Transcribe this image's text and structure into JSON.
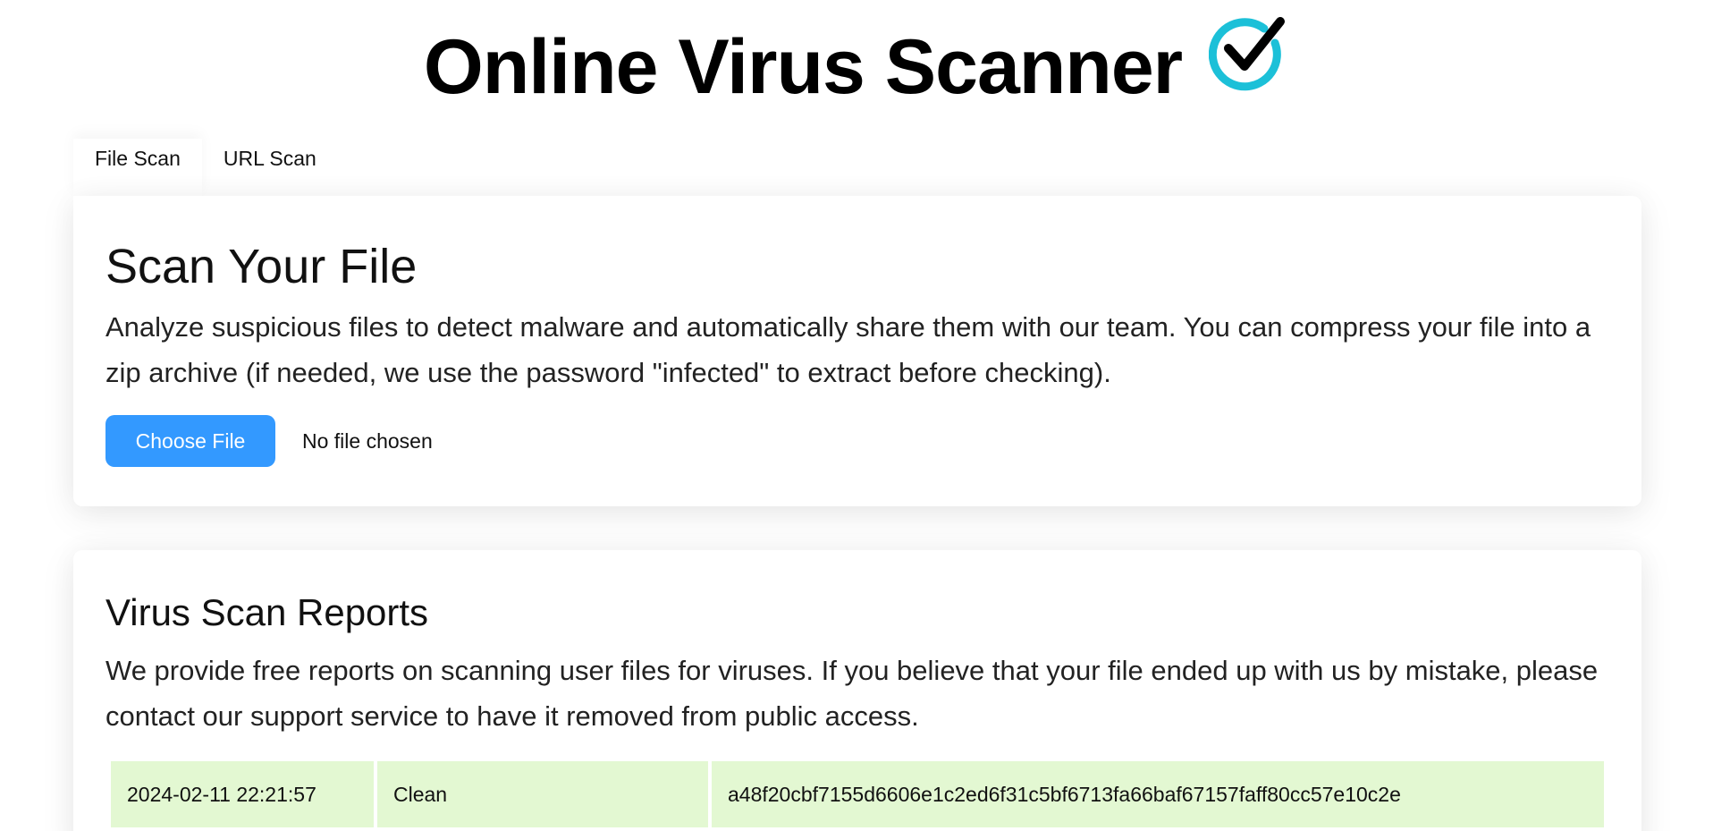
{
  "header": {
    "title": "Online Virus Scanner",
    "icon": "check-circle-icon",
    "icon_color": "#1cc0d8"
  },
  "tabs": [
    {
      "label": "File Scan",
      "active": true
    },
    {
      "label": "URL Scan",
      "active": false
    }
  ],
  "scan_card": {
    "title": "Scan Your File",
    "description": "Analyze suspicious files to detect malware and automatically share them with our team. You can compress your file into a zip archive (if needed, we use the password \"infected\" to extract before checking).",
    "choose_button": "Choose File",
    "file_status": "No file chosen",
    "button_color": "#3399ff"
  },
  "reports_card": {
    "title": "Virus Scan Reports",
    "description": "We provide free reports on scanning user files for viruses. If you believe that your file ended up with us by mistake, please contact our support service to have it removed from public access.",
    "rows": [
      {
        "date": "2024-02-11 22:21:57",
        "status": "Clean",
        "hash": "a48f20cbf7155d6606e1c2ed6f31c5bf6713fa66baf67157faff80cc57e10c2e"
      }
    ],
    "row_color": "#e3f8d2"
  }
}
